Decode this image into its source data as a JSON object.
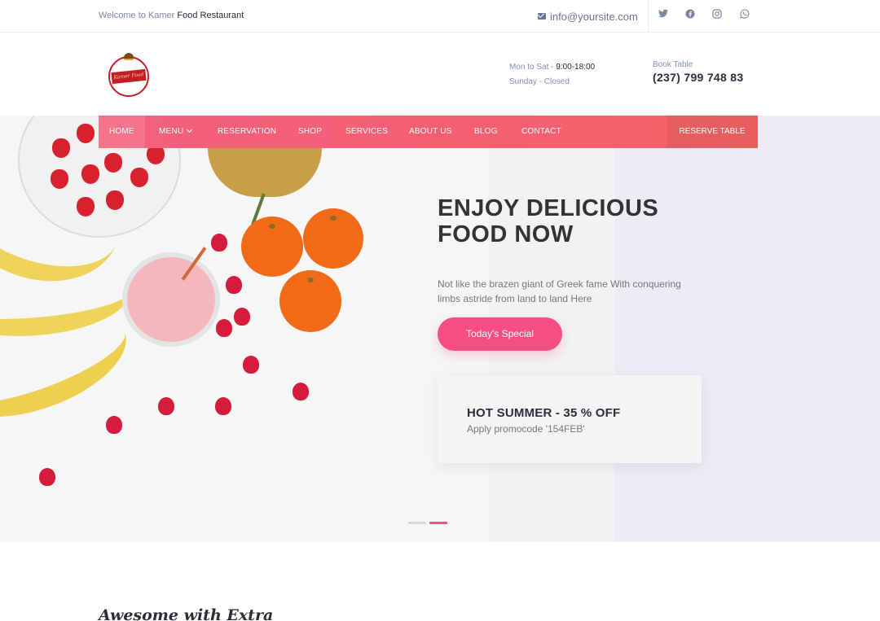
{
  "topbar": {
    "welcome_prefix": "Welcome to Kamer ",
    "welcome_strong": "Food Restaurant",
    "email": "info@yoursite.com",
    "social": [
      "twitter-icon",
      "facebook-icon",
      "instagram-icon",
      "whatsapp-icon"
    ]
  },
  "header": {
    "logo_text": "Kamer Food",
    "hours_weekday_label": "Mon to Sat - ",
    "hours_weekday_value": "9:00-18:00",
    "hours_sunday": "Sunday - Closed",
    "book_label": "Book Table",
    "book_phone": "(237) 799 748 83"
  },
  "nav": {
    "items": [
      "HOME",
      "MENU",
      "RESERVATION",
      "SHOP",
      "SERVICES",
      "ABOUT US",
      "BLOG",
      "CONTACT"
    ],
    "reserve": "RESERVE TABLE"
  },
  "hero": {
    "title_line1": "ENJOY DELICIOUS",
    "title_line2": "FOOD NOW",
    "text": "Not like the brazen giant of Greek fame With conquering limbs astride from land to land Here",
    "cta": "Today's Special",
    "promo_title": "HOT SUMMER - 35 % OFF",
    "promo_sub": "Apply promocode '154FEB'",
    "slides": 2,
    "active_slide": 2
  },
  "section": {
    "title": "Awesome with Extra"
  },
  "colors": {
    "accent": "#f54e83",
    "nav_gradient_start": "#f3617d",
    "nav_gradient_end": "#f66463",
    "dark_text": "#2c2c3a"
  }
}
